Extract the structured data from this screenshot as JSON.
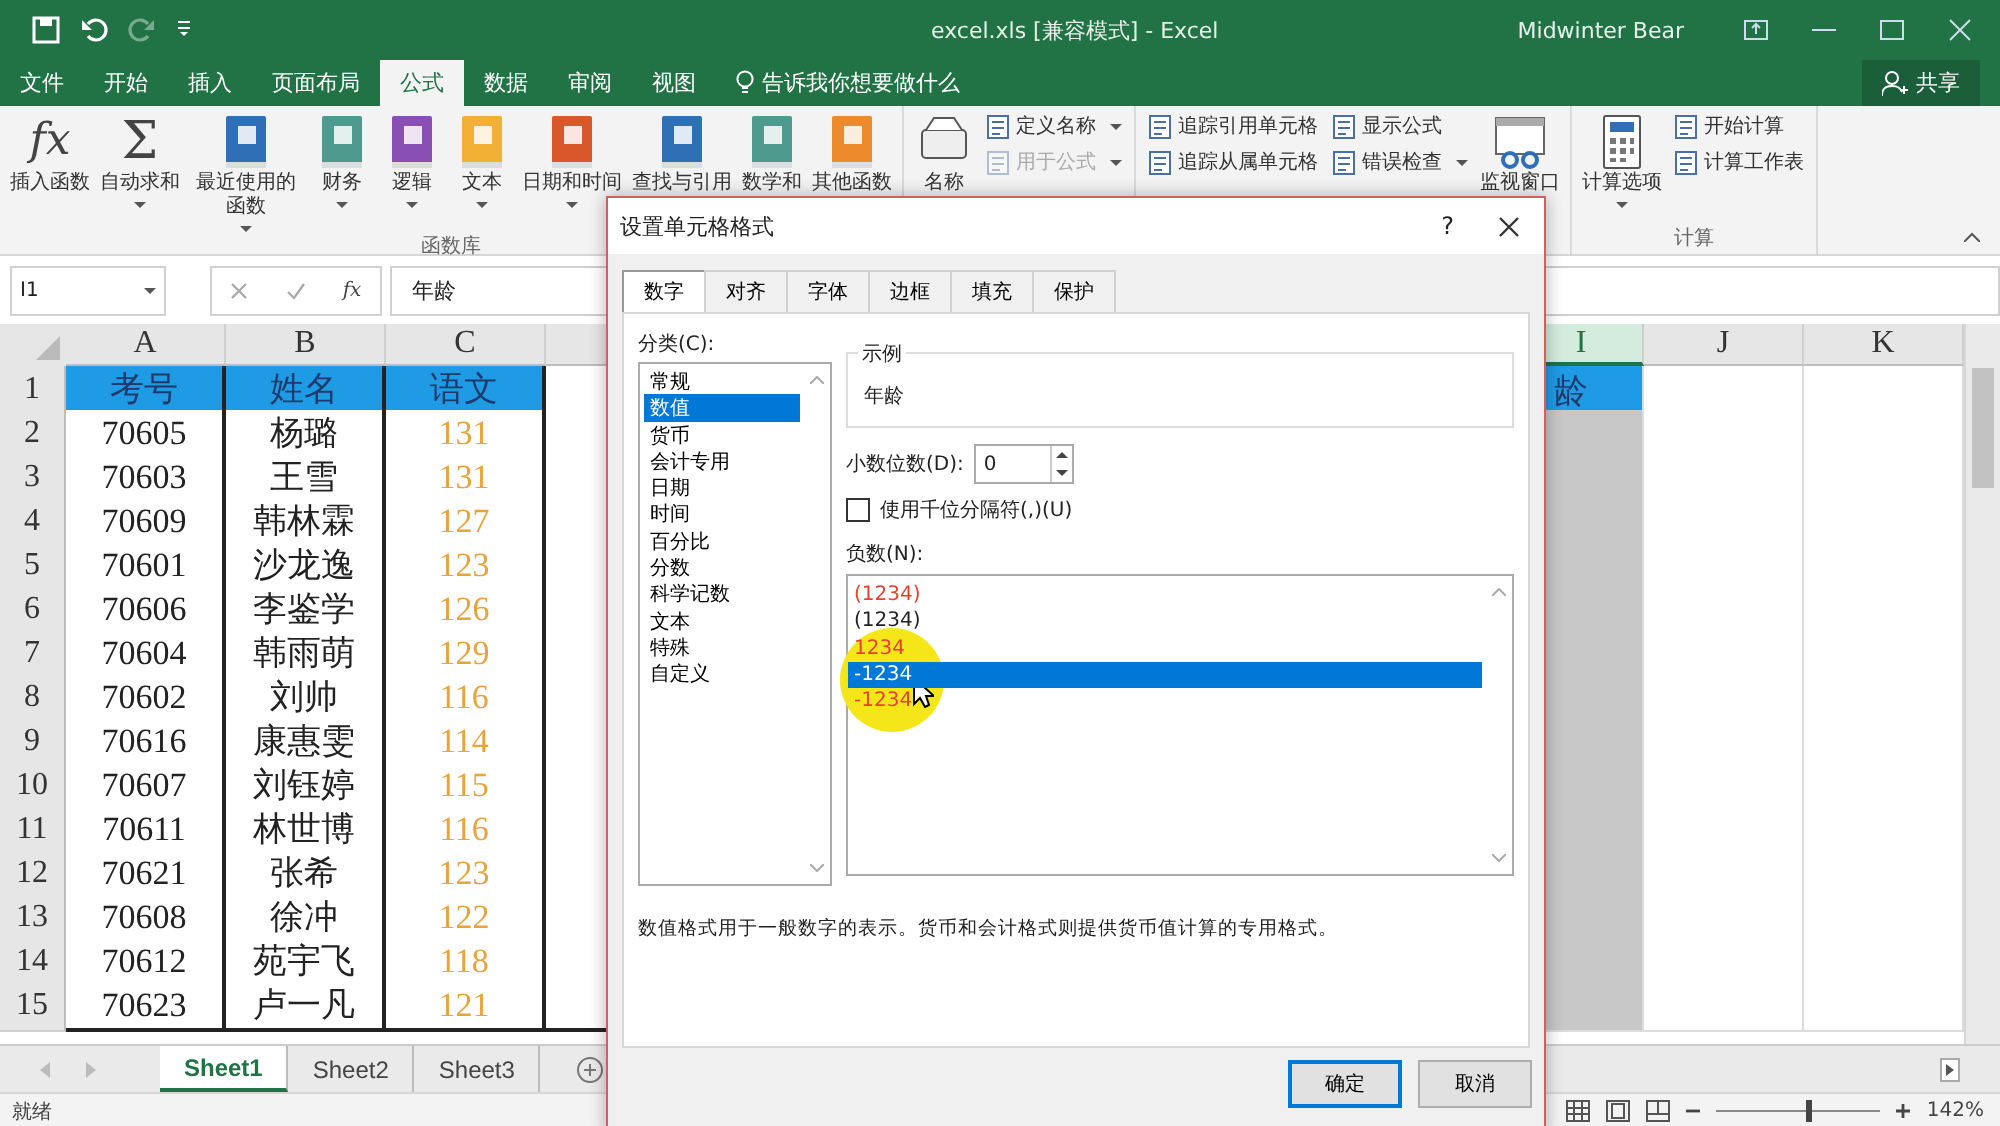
{
  "window": {
    "title": "excel.xls  [兼容模式]  -  Excel",
    "user": "Midwinter Bear"
  },
  "quick_access": [
    {
      "disabled": false
    },
    {
      "disabled": false
    },
    {
      "disabled": true
    },
    {
      "disabled": false
    }
  ],
  "ribbon_tabs": [
    {
      "label": "文件",
      "selected": false
    },
    {
      "label": "开始",
      "selected": false
    },
    {
      "label": "插入",
      "selected": false
    },
    {
      "label": "页面布局",
      "selected": false
    },
    {
      "label": "公式",
      "selected": true
    },
    {
      "label": "数据",
      "selected": false
    },
    {
      "label": "审阅",
      "selected": false
    },
    {
      "label": "视图",
      "selected": false
    }
  ],
  "tell_me": "告诉我你想要做什么",
  "share": "共享",
  "ribbon_groups": [
    {
      "label": "函数库",
      "commands": [
        {
          "kind": "large",
          "glyph": "fx",
          "label": "插入函数",
          "dropdown": false
        },
        {
          "kind": "large",
          "glyph": "Σ",
          "label": "自动求和",
          "dropdown": true
        },
        {
          "kind": "large",
          "label": "最近使用的函数",
          "dropdown": true
        },
        {
          "kind": "large",
          "label": "财务",
          "dropdown": true
        },
        {
          "kind": "large",
          "label": "逻辑",
          "dropdown": true
        },
        {
          "kind": "large",
          "label": "文本",
          "dropdown": true
        },
        {
          "kind": "large",
          "label": "日期和时间",
          "dropdown": true
        },
        {
          "kind": "large",
          "label": "查找与引用",
          "dropdown": false
        },
        {
          "kind": "large",
          "label": "数学和",
          "dropdown": false
        },
        {
          "kind": "large",
          "label": "其他函数",
          "dropdown": false
        }
      ]
    },
    {
      "commands": [
        {
          "kind": "large",
          "label": "名称",
          "dropdown": false
        },
        {
          "kind": "stack",
          "items": [
            {
              "label": "定义名称",
              "dropdown": true,
              "disabled": false
            },
            {
              "label": "用于公式",
              "dropdown": true,
              "disabled": true
            }
          ]
        }
      ]
    },
    {
      "commands": [
        {
          "kind": "stack",
          "items": [
            {
              "label": "追踪引用单元格",
              "dropdown": false,
              "disabled": false
            },
            {
              "label": "追踪从属单元格",
              "dropdown": false,
              "disabled": false
            }
          ]
        },
        {
          "kind": "stack",
          "items": [
            {
              "label": "显示公式",
              "dropdown": false,
              "disabled": false
            },
            {
              "label": "错误检查",
              "dropdown": true,
              "disabled": false
            }
          ]
        },
        {
          "kind": "large",
          "label": "监视窗口",
          "dropdown": false
        }
      ]
    },
    {
      "label": "计算",
      "commands": [
        {
          "kind": "large",
          "label": "计算选项",
          "dropdown": true
        },
        {
          "kind": "stack",
          "items": [
            {
              "label": "开始计算",
              "dropdown": false,
              "disabled": false
            },
            {
              "label": "计算工作表",
              "dropdown": false,
              "disabled": false
            }
          ]
        }
      ]
    }
  ],
  "formula_bar": {
    "name_box": "I1",
    "fx": "fx",
    "value": "年龄"
  },
  "sheet": {
    "columns": [
      {
        "letter": "A",
        "kind": "id",
        "selected": false
      },
      {
        "letter": "B",
        "kind": "name",
        "selected": false
      },
      {
        "letter": "C",
        "kind": "score",
        "selected": false
      },
      {
        "letter": "I",
        "kind": "blank",
        "selected": true
      },
      {
        "letter": "J",
        "kind": "blank",
        "selected": false
      },
      {
        "letter": "K",
        "kind": "blank",
        "selected": false
      }
    ],
    "rows": [
      {
        "number": "1",
        "kind": "header",
        "cells": [
          "考号",
          "姓名",
          "语文",
          "龄"
        ]
      },
      {
        "number": "2",
        "kind": "data",
        "cells": [
          "70605",
          "杨璐",
          "131"
        ]
      },
      {
        "number": "3",
        "kind": "data",
        "cells": [
          "70603",
          "王雪",
          "131"
        ]
      },
      {
        "number": "4",
        "kind": "data",
        "cells": [
          "70609",
          "韩林霖",
          "127"
        ]
      },
      {
        "number": "5",
        "kind": "data",
        "cells": [
          "70601",
          "沙龙逸",
          "123"
        ]
      },
      {
        "number": "6",
        "kind": "data",
        "cells": [
          "70606",
          "李鉴学",
          "126"
        ]
      },
      {
        "number": "7",
        "kind": "data",
        "cells": [
          "70604",
          "韩雨萌",
          "129"
        ]
      },
      {
        "number": "8",
        "kind": "data",
        "cells": [
          "70602",
          "刘帅",
          "116"
        ]
      },
      {
        "number": "9",
        "kind": "data",
        "cells": [
          "70616",
          "康惠雯",
          "114"
        ]
      },
      {
        "number": "10",
        "kind": "data",
        "cells": [
          "70607",
          "刘钰婷",
          "115"
        ]
      },
      {
        "number": "11",
        "kind": "data",
        "cells": [
          "70611",
          "林世博",
          "116"
        ]
      },
      {
        "number": "12",
        "kind": "data",
        "cells": [
          "70621",
          "张希",
          "123"
        ]
      },
      {
        "number": "13",
        "kind": "data",
        "cells": [
          "70608",
          "徐冲",
          "122"
        ]
      },
      {
        "number": "14",
        "kind": "data",
        "cells": [
          "70612",
          "苑宇飞",
          "118"
        ]
      },
      {
        "number": "15",
        "kind": "data",
        "cells": [
          "70623",
          "卢一凡",
          "121"
        ]
      }
    ]
  },
  "sheet_tabs": [
    {
      "label": "Sheet1",
      "selected": true
    },
    {
      "label": "Sheet2",
      "selected": false
    },
    {
      "label": "Sheet3",
      "selected": false
    }
  ],
  "status_bar": {
    "text": "就绪",
    "zoom": "142%",
    "zoom_slider": {
      "level": 0.55
    }
  },
  "dialog": {
    "title": "设置单元格格式",
    "help": "?",
    "tabs": [
      {
        "label": "数字",
        "selected": true
      },
      {
        "label": "对齐",
        "selected": false
      },
      {
        "label": "字体",
        "selected": false
      },
      {
        "label": "边框",
        "selected": false
      },
      {
        "label": "填充",
        "selected": false
      },
      {
        "label": "保护",
        "selected": false
      }
    ],
    "category_label": "分类(C):",
    "categories": [
      {
        "label": "常规",
        "selected": false
      },
      {
        "label": "数值",
        "selected": true
      },
      {
        "label": "货币",
        "selected": false
      },
      {
        "label": "会计专用",
        "selected": false
      },
      {
        "label": "日期",
        "selected": false
      },
      {
        "label": "时间",
        "selected": false
      },
      {
        "label": "百分比",
        "selected": false
      },
      {
        "label": "分数",
        "selected": false
      },
      {
        "label": "科学记数",
        "selected": false
      },
      {
        "label": "文本",
        "selected": false
      },
      {
        "label": "特殊",
        "selected": false
      },
      {
        "label": "自定义",
        "selected": false
      }
    ],
    "sample_label": "示例",
    "sample_value": "年龄",
    "decimal_label": "小数位数(D):",
    "decimal_value": "0",
    "thousands": {
      "label": "使用千位分隔符(,)(U)",
      "checked": false
    },
    "negative_label": "负数(N):",
    "negative_formats": [
      {
        "text": "(1234)",
        "color": "#e8402f",
        "selected": false
      },
      {
        "text": "(1234)",
        "color": "#222222",
        "selected": false
      },
      {
        "text": "1234",
        "color": "#e8402f",
        "selected": false
      },
      {
        "text": "-1234",
        "selected": true
      },
      {
        "text": "-1234",
        "color": "#e8402f",
        "selected": false
      }
    ],
    "description": "数值格式用于一般数字的表示。货币和会计格式则提供货币值计算的专用格式。",
    "buttons": [
      {
        "label": "确定",
        "kind": "default"
      },
      {
        "label": "取消",
        "kind": "normal"
      }
    ]
  }
}
